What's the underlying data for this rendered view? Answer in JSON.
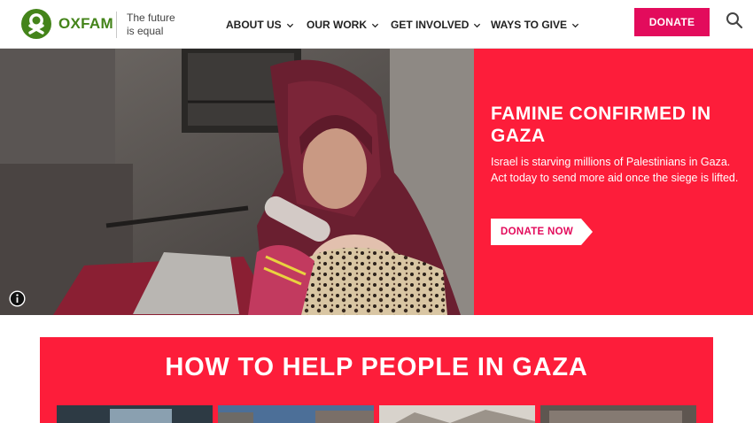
{
  "brand": {
    "name": "OXFAM",
    "tagline_line1": "The future",
    "tagline_line2": "is equal",
    "color": "#44841a"
  },
  "nav": {
    "items": [
      {
        "label": "ABOUT US"
      },
      {
        "label": "OUR WORK"
      },
      {
        "label": "GET INVOLVED"
      },
      {
        "label": "WAYS TO GIVE"
      }
    ]
  },
  "header": {
    "donate_label": "DONATE",
    "donate_color": "#e30b5c",
    "search_icon": "search-icon"
  },
  "hero": {
    "title": "FAMINE CONFIRMED IN GAZA",
    "text": "Israel is starving millions of Palestinians in Gaza. Act today to send more aid once the siege is lifted.",
    "cta_label": "DONATE NOW",
    "panel_color": "#fd1d3a",
    "info_icon": "info-icon"
  },
  "help_section": {
    "title": "HOW TO HELP PEOPLE IN GAZA"
  }
}
